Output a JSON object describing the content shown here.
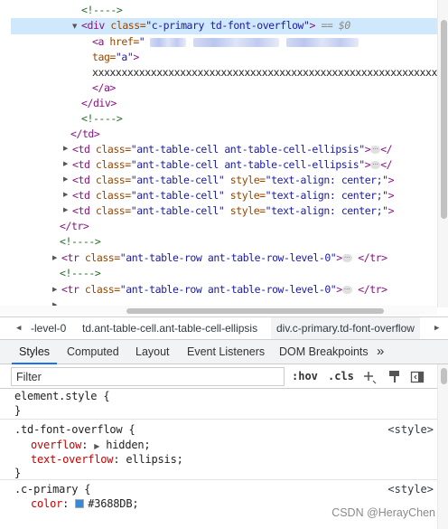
{
  "tree": {
    "lines": [
      {
        "text": "<!---->"
      },
      {
        "tag_open": "<div",
        "attr": " class=",
        "val": "\"c-primary td-font-overflow\"",
        "tag_close": ">",
        "suffix": " == $0"
      },
      {
        "tag_open": "<a",
        "attr": " href=",
        "val": "\""
      },
      {
        "attr": "tag=",
        "val": "\"a\"",
        "tag_close": ">"
      },
      {
        "text": "xxxxxxxxxxxxxxxxxxxxxxxxxxxxxxxxxxxxxxxxxxxxxxxxxxxxxxxxxxxxxx"
      },
      {
        "text": "</a>"
      },
      {
        "text": "</div>"
      },
      {
        "text": "<!---->"
      },
      {
        "text": "</td>"
      },
      {
        "tag_open": "<td",
        "attr": " class=",
        "val": "\"ant-table-cell ant-table-cell-ellipsis\"",
        "tag_close": ">",
        "end": "</"
      },
      {
        "tag_open": "<td",
        "attr": " class=",
        "val": "\"ant-table-cell ant-table-cell-ellipsis\"",
        "tag_close": ">",
        "end": "</"
      },
      {
        "tag_open": "<td",
        "attr": " class=",
        "val": "\"ant-table-cell\"",
        "attr2": " style=",
        "val2": "\"text-align: center;\"",
        "tag_close": ">"
      },
      {
        "tag_open": "<td",
        "attr": " class=",
        "val": "\"ant-table-cell\"",
        "attr2": " style=",
        "val2": "\"text-align: center;\"",
        "tag_close": ">"
      },
      {
        "tag_open": "<td",
        "attr": " class=",
        "val": "\"ant-table-cell\"",
        "attr2": " style=",
        "val2": "\"text-align: center;\"",
        "tag_close": ">"
      },
      {
        "text": "</tr>"
      },
      {
        "text": "<!---->"
      },
      {
        "tag_open": "<tr",
        "attr": " class=",
        "val": "\"ant-table-row ant-table-row-level-0\"",
        "tag_close": ">",
        "end": "</tr>"
      },
      {
        "text": "<!---->"
      },
      {
        "tag_open": "<tr",
        "attr": " class=",
        "val": "\"ant-table-row ant-table-row-level-0\"",
        "tag_close": ">",
        "end": "</tr>"
      }
    ]
  },
  "breadcrumbs": [
    "-level-0",
    "td.ant-table-cell.ant-table-cell-ellipsis",
    "div.c-primary.td-font-overflow"
  ],
  "tabs": [
    "Styles",
    "Computed",
    "Layout",
    "Event Listeners",
    "DOM Breakpoints"
  ],
  "tabs_more": "»",
  "filter": {
    "placeholder": "Filter",
    "hov": ":hov",
    "cls": ".cls"
  },
  "styles": {
    "element_style": {
      "selector": "element.style {",
      "close": "}"
    },
    "rule1": {
      "selector": ".td-font-overflow {",
      "source": "<style>",
      "p1_name": "overflow",
      "p1_value": "hidden;",
      "p2_name": "text-overflow",
      "p2_value": "ellipsis;",
      "close": "}"
    },
    "rule2": {
      "selector": ".c-primary {",
      "source": "<style>",
      "p1_name": "color",
      "p1_value": "#3688DB;",
      "swatch_color": "#3688DB"
    }
  },
  "watermark": "CSDN @HerayChen"
}
